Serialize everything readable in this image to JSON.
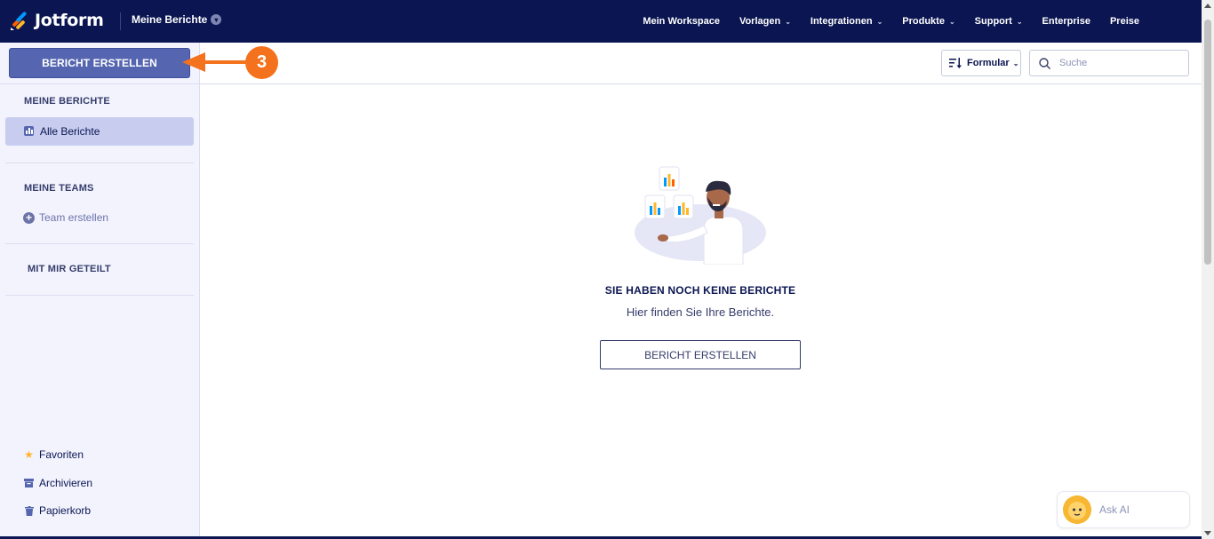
{
  "header": {
    "brand": "Jotform",
    "page_name": "Meine Berichte",
    "nav": [
      {
        "label": "Mein Workspace",
        "has_dropdown": false
      },
      {
        "label": "Vorlagen",
        "has_dropdown": true
      },
      {
        "label": "Integrationen",
        "has_dropdown": true
      },
      {
        "label": "Produkte",
        "has_dropdown": true
      },
      {
        "label": "Support",
        "has_dropdown": true
      },
      {
        "label": "Enterprise",
        "has_dropdown": false
      },
      {
        "label": "Preise",
        "has_dropdown": false
      }
    ]
  },
  "sidebar": {
    "create_button": "BERICHT ERSTELLEN",
    "my_reports_heading": "MEINE BERICHTE",
    "all_reports": "Alle Berichte",
    "my_teams_heading": "MEINE TEAMS",
    "create_team": "Team erstellen",
    "shared_heading": "MIT MIR GETEILT",
    "favorites": "Favoriten",
    "archive": "Archivieren",
    "trash": "Papierkorb"
  },
  "annotation": {
    "step_number": "3",
    "color": "#f4721d"
  },
  "toolbar": {
    "sort_label": "Formular",
    "search_placeholder": "Suche"
  },
  "empty_state": {
    "title": "SIE HABEN NOCH KEINE BERICHTE",
    "subtitle": "Hier finden Sie Ihre Berichte.",
    "button": "BERICHT ERSTELLEN"
  },
  "ask_ai": {
    "label": "Ask AI"
  },
  "colors": {
    "nav_bg": "#0a1551",
    "primary_button": "#5565b0",
    "sidebar_bg": "#f3f3fe",
    "active_item": "#c8cdf0"
  }
}
